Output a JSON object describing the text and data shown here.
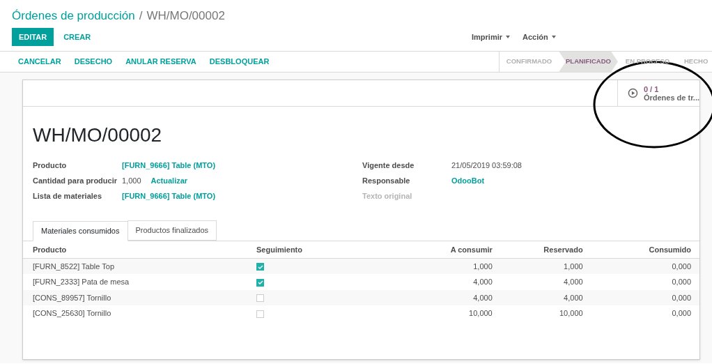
{
  "breadcrumb": {
    "parent": "Órdenes de producción",
    "separator": "/",
    "current": "WH/MO/00002"
  },
  "buttons": [
    {
      "label": "EDITAR",
      "kind": "primary"
    },
    {
      "label": "CREAR",
      "kind": "link"
    }
  ],
  "dropdowns": [
    "Imprimir",
    "Acción"
  ],
  "actions": [
    "CANCELAR",
    "DESECHO",
    "ANULAR RESERVA",
    "DESBLOQUEAR"
  ],
  "statusbar": [
    {
      "label": "CONFIRMADO",
      "selected": false
    },
    {
      "label": "PLANIFICADO",
      "selected": true
    },
    {
      "label": "EN PROCESO",
      "selected": false
    },
    {
      "label": "HECHO",
      "selected": false
    }
  ],
  "smart_button": {
    "value": "0 / 1",
    "label": "Órdenes de tr..."
  },
  "record_name": "WH/MO/00002",
  "fields_left": [
    {
      "label": "Producto",
      "value": "[FURN_9666] Table (MTO)",
      "kind": "link"
    },
    {
      "label": "Cantidad para producir",
      "value": "1,000",
      "kind": "text",
      "action": "Actualizar"
    },
    {
      "label": "Lista de materiales",
      "value": "[FURN_9666] Table (MTO)",
      "kind": "link"
    }
  ],
  "fields_right": [
    {
      "label": "Vigente desde",
      "value": "21/05/2019 03:59:08",
      "kind": "text"
    },
    {
      "label": "Responsable",
      "value": "OdooBot",
      "kind": "link"
    },
    {
      "label": "Texto original",
      "kind": "placeholder"
    }
  ],
  "tabs": [
    {
      "label": "Materiales consumidos",
      "selected": true
    },
    {
      "label": "Productos finalizados",
      "selected": false
    }
  ],
  "table": {
    "columns": [
      "Producto",
      "Seguimiento",
      "A consumir",
      "Reservado",
      "Consumido"
    ],
    "rows": [
      {
        "product": "[FURN_8522] Table Top",
        "tracking": true,
        "to_consume": "1,000",
        "reserved": "1,000",
        "consumed": "0,000"
      },
      {
        "product": "[FURN_2333] Pata de mesa",
        "tracking": true,
        "to_consume": "4,000",
        "reserved": "4,000",
        "consumed": "0,000"
      },
      {
        "product": "[CONS_89957] Tornillo",
        "tracking": false,
        "to_consume": "4,000",
        "reserved": "4,000",
        "consumed": "0,000"
      },
      {
        "product": "[CONS_25630] Tornillo",
        "tracking": false,
        "to_consume": "10,000",
        "reserved": "10,000",
        "consumed": "0,000"
      }
    ]
  }
}
